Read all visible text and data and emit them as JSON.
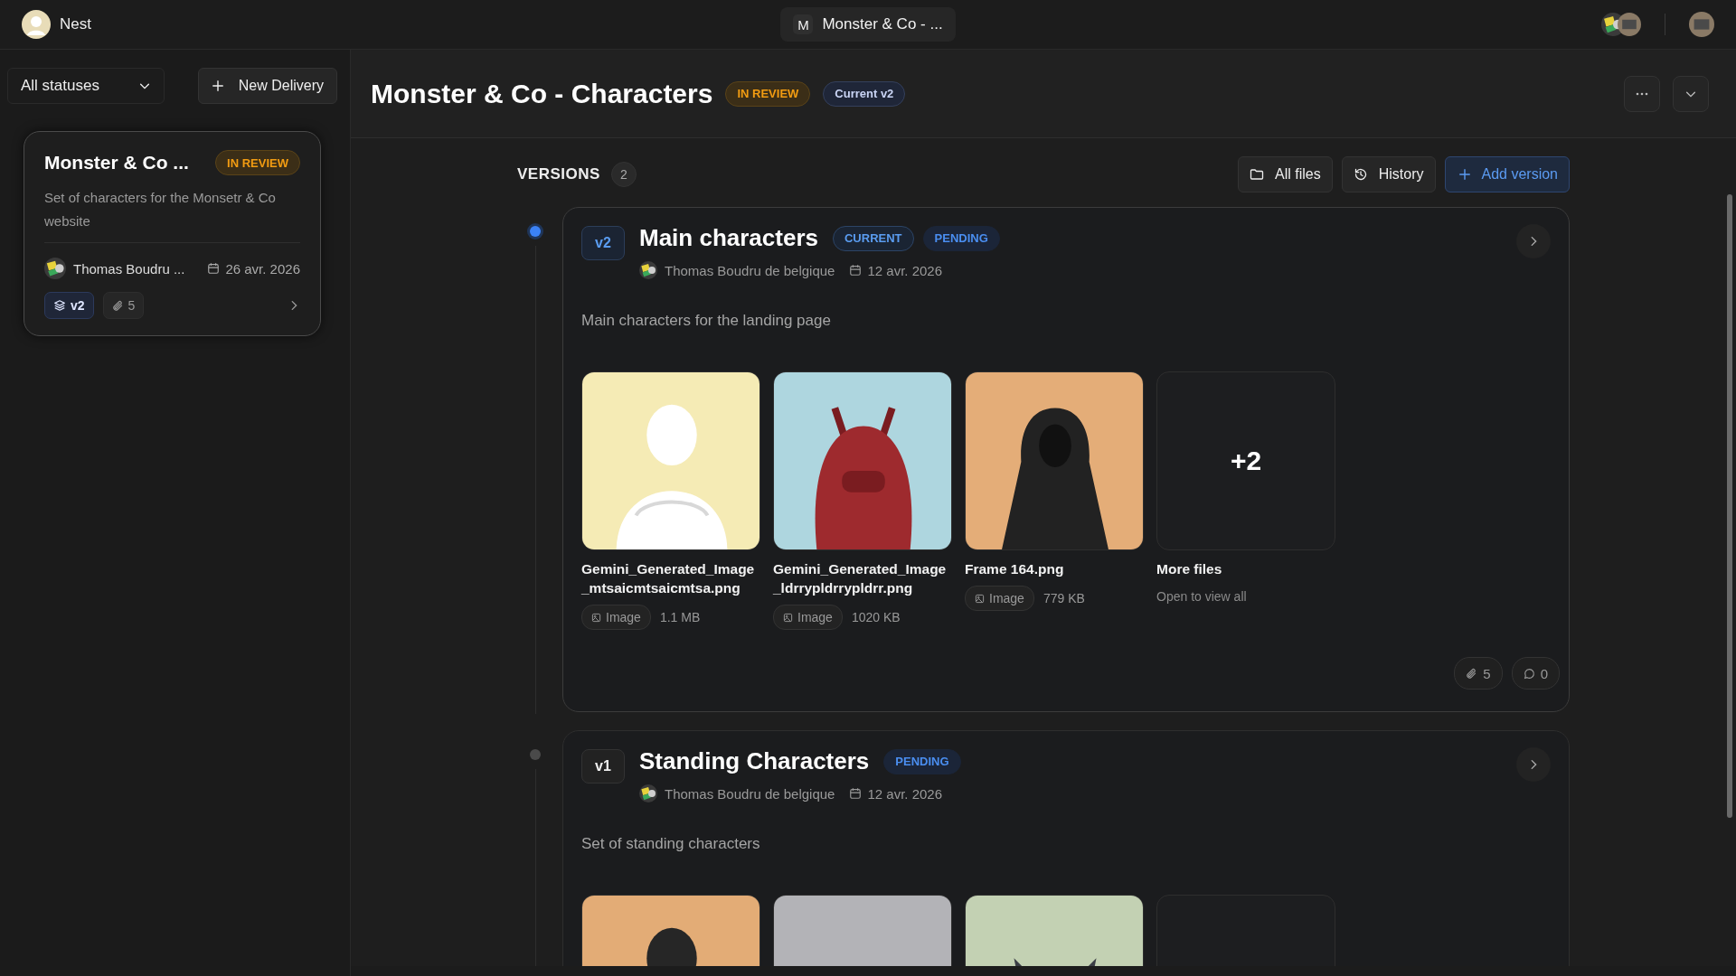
{
  "app": {
    "name": "Nest"
  },
  "top_bar": {
    "project_initial": "M",
    "project_title": "Monster & Co - ..."
  },
  "sidebar": {
    "filter": "All statuses",
    "new_button": "New Delivery",
    "deliveries": [
      {
        "title": "Monster & Co ...",
        "status": "IN REVIEW",
        "description": "Set of characters for the Monsetr & Co website",
        "author": "Thomas Boudru ...",
        "date": "26 avr. 2026",
        "version": "v2",
        "attachments": "5",
        "selected": true
      }
    ]
  },
  "header": {
    "title": "Monster & Co - Characters",
    "status": "IN REVIEW",
    "current": "Current v2"
  },
  "versions": {
    "label": "VERSIONS",
    "count": "2",
    "actions": [
      {
        "label": "All files",
        "kind": "folder"
      },
      {
        "label": "History",
        "kind": "history"
      },
      {
        "label": "Add version",
        "kind": "add"
      }
    ],
    "items": [
      {
        "tag": "v2",
        "title": "Main characters",
        "active": true,
        "badges": [
          {
            "label": "CURRENT",
            "kind": "current"
          },
          {
            "label": "PENDING",
            "kind": "pending"
          }
        ],
        "author": "Thomas Boudru de belgique",
        "date": "12 avr. 2026",
        "description": "Main characters for the landing page",
        "files": [
          {
            "kind": "picture",
            "name": "Gemini_Generated_Image_mtsaicmtsaicmtsa.png",
            "type": "Image",
            "size": "1.1 MB"
          },
          {
            "kind": "picture",
            "name": "Gemini_Generated_Image_ldrrypldrrypldrr.png",
            "type": "Image",
            "size": "1020 KB"
          },
          {
            "kind": "picture",
            "name": "Frame 164.png",
            "type": "Image",
            "size": "779 KB"
          },
          {
            "kind": "more",
            "count": "+2",
            "name": "More files",
            "hint": "Open to view all"
          }
        ],
        "attachments": "5",
        "comments": "0"
      },
      {
        "tag": "v1",
        "title": "Standing Characters",
        "active": false,
        "badges": [
          {
            "label": "PENDING",
            "kind": "pending"
          }
        ],
        "author": "Thomas Boudru de belgique",
        "date": "12 avr. 2026",
        "description": "Set of standing characters",
        "files": [
          {
            "kind": "picture"
          },
          {
            "kind": "picture"
          },
          {
            "kind": "picture"
          },
          {
            "kind": "more"
          }
        ]
      }
    ]
  }
}
